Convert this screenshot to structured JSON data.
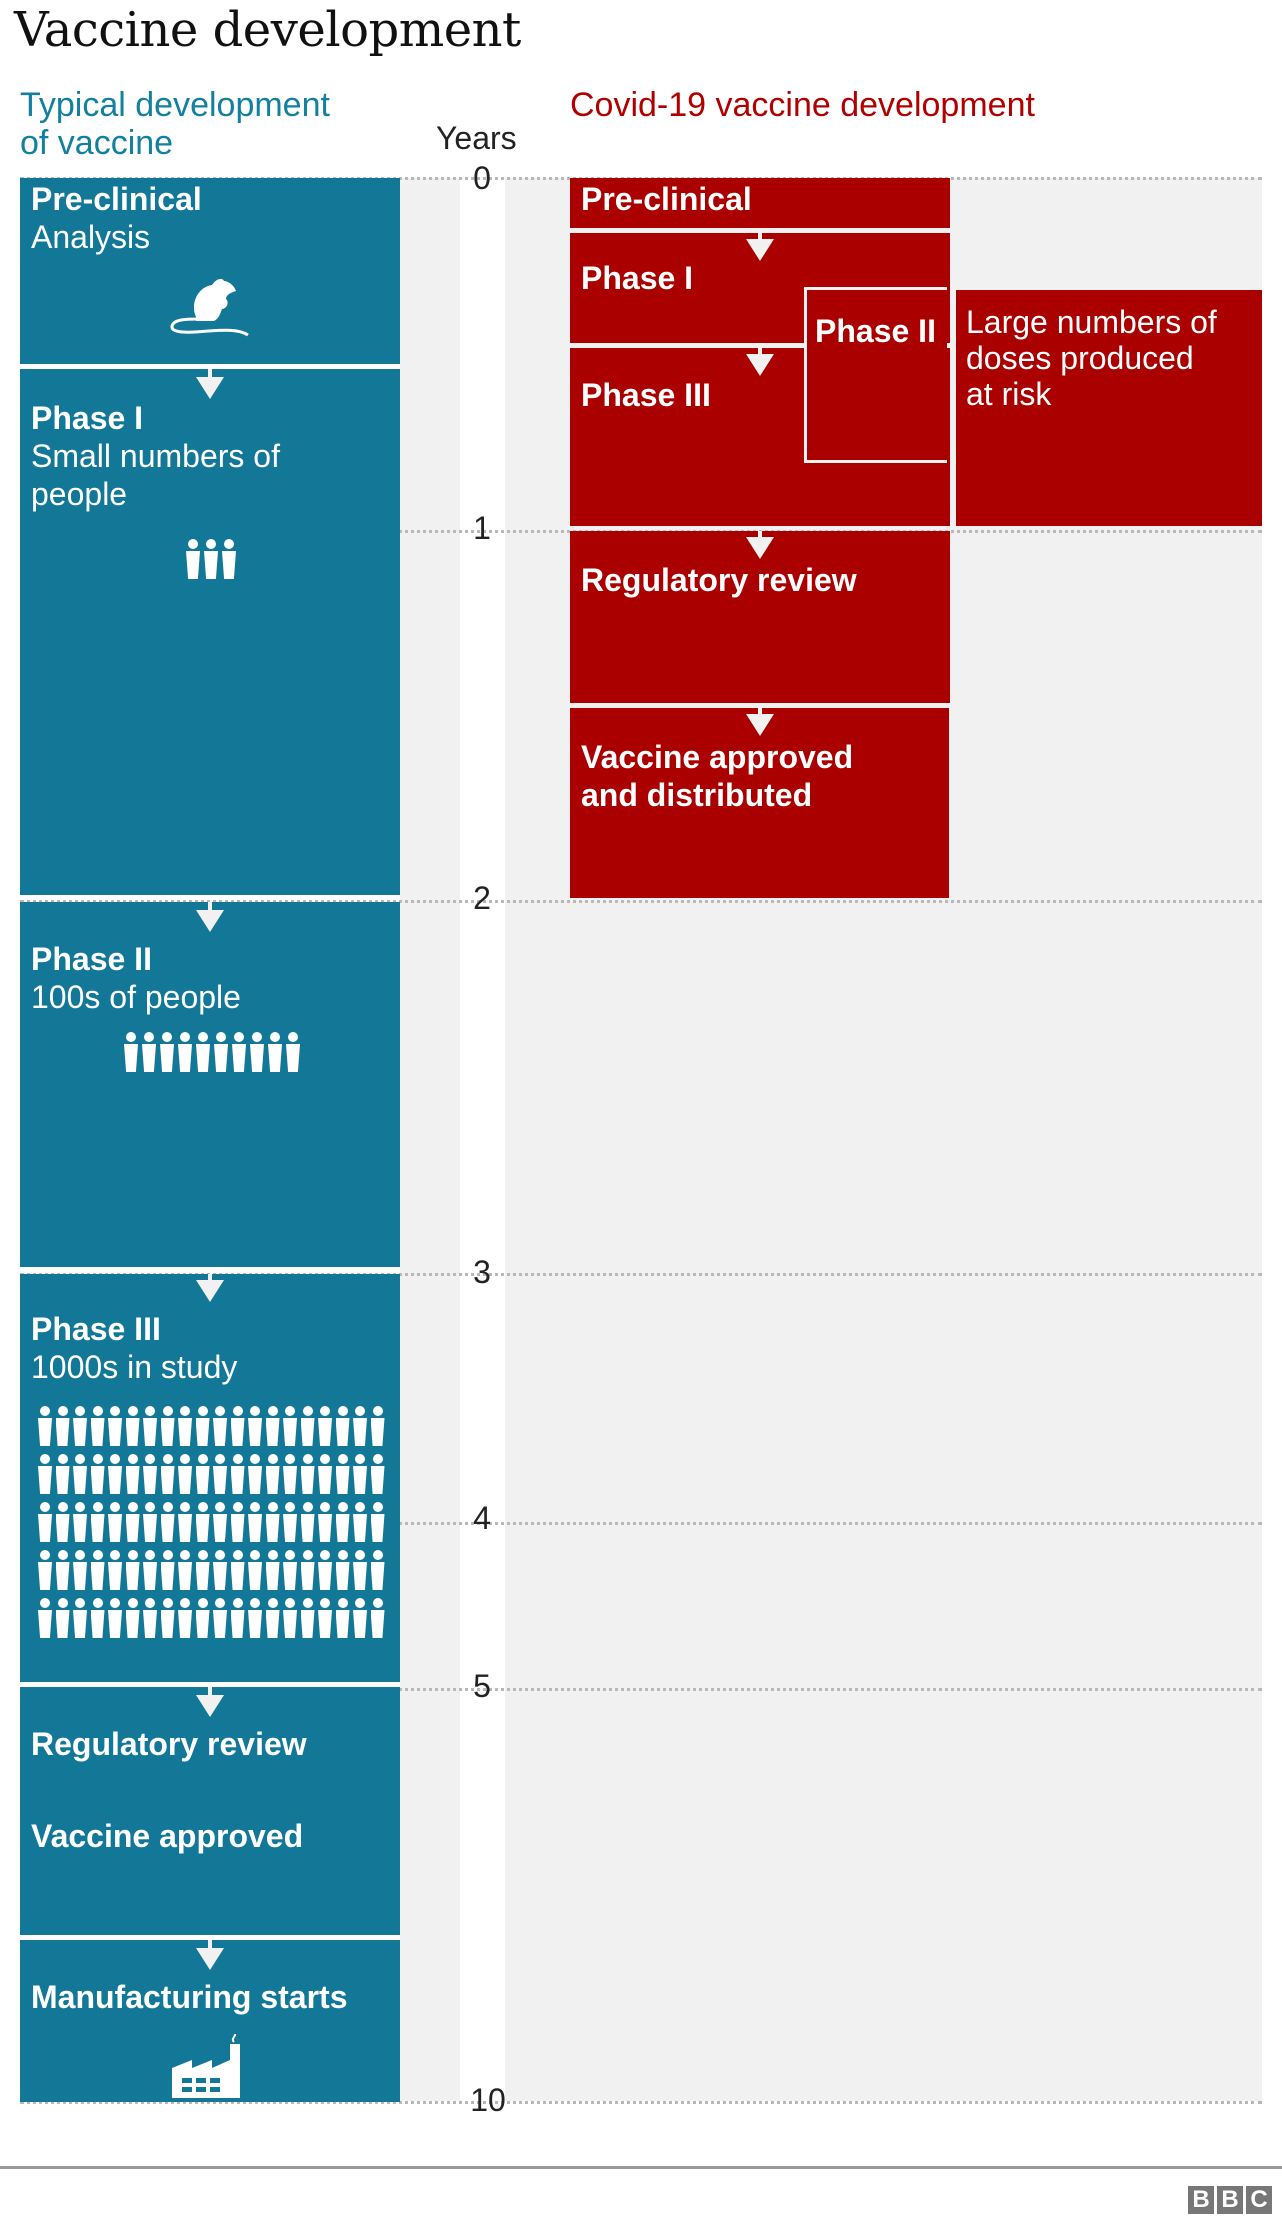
{
  "title": "Vaccine development",
  "typical": {
    "heading_line1": "Typical development",
    "heading_line2": "of vaccine",
    "color": "#1380a1",
    "stages": [
      {
        "title": "Pre-clinical",
        "subtitle": "Analysis",
        "icon": "mouse-icon",
        "start_year": 0,
        "end_year": 0.5
      },
      {
        "title": "Phase I",
        "subtitle_line1": "Small numbers of",
        "subtitle_line2": "people",
        "icon": "people-icon",
        "people_count": 3,
        "start_year": 0.5,
        "end_year": 2
      },
      {
        "title": "Phase II",
        "subtitle": "100s of people",
        "icon": "people-icon",
        "people_count": 10,
        "start_year": 2,
        "end_year": 3
      },
      {
        "title": "Phase III",
        "subtitle": "1000s in study",
        "icon": "people-icon",
        "people_rows": 5,
        "people_per_row": 20,
        "start_year": 3,
        "end_year": 5
      },
      {
        "title": "Regulatory review",
        "title2": "Vaccine approved",
        "start_year": 5,
        "end_year": 7
      },
      {
        "title": "Manufacturing starts",
        "icon": "factory-icon",
        "start_year": 7,
        "end_year": 10
      }
    ]
  },
  "covid": {
    "heading": "Covid-19 vaccine development",
    "color": "#aa0000",
    "stages": [
      {
        "title": "Pre-clinical",
        "start_year": 0,
        "end_year": 0.15
      },
      {
        "title": "Phase I",
        "start_year": 0.15,
        "end_year": 0.5
      },
      {
        "title": "Phase II",
        "start_year": 0.35,
        "end_year": 0.85,
        "overlapping": true
      },
      {
        "title": "Phase III",
        "start_year": 0.5,
        "end_year": 1
      },
      {
        "title": "Regulatory review",
        "start_year": 1,
        "end_year": 1.5
      },
      {
        "title_line1": "Vaccine approved",
        "title_line2": "and distributed",
        "start_year": 1.5,
        "end_year": 2
      }
    ],
    "side_note": {
      "line1": "Large numbers of",
      "line2": "doses produced",
      "line3": "at risk",
      "start_year": 0.3,
      "end_year": 1
    }
  },
  "axis": {
    "label": "Years",
    "ticks": [
      "0",
      "1",
      "2",
      "3",
      "4",
      "5",
      "10"
    ]
  },
  "footer": {
    "logo_letters": [
      "B",
      "B",
      "C"
    ]
  },
  "colors": {
    "teal": "#137898",
    "red": "#aa0000",
    "grey_bg": "#f1f1f1"
  }
}
